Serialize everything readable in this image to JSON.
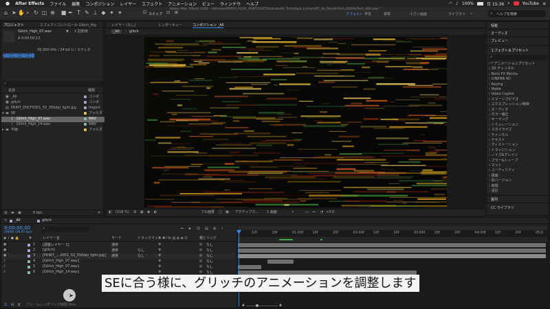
{
  "menubar": {
    "apple": "",
    "app_name": "After Effects",
    "items": [
      "ファイル",
      "編集",
      "コンポジション",
      "レイヤー",
      "エフェクト",
      "アニメーション",
      "ビュー",
      "ウィンドウ",
      "ヘルプ"
    ],
    "battery": "100%",
    "date": "日 15:36",
    "youtube": "YouTube"
  },
  "toolbar": {
    "window_title": "Adobe After Effects 2020 - /Volumes/PORT8_01/01_PORTEIGHT/Youtube/AE_Technique_Lecture/01_Ae_Rec/AeTech_004/AeTech_004.aep *",
    "snap_label": "スナップ",
    "workspaces": [
      "デフォルト",
      "学習",
      "標準",
      "小さい画面",
      "ライブラリ"
    ],
    "help_search": "ヘルプを検索"
  },
  "project": {
    "tab": "プロジェクト",
    "effect_controls_tab": "エフェクトコントロール Glitch_Hig",
    "file_name": "Glitch_High_07.wav",
    "file_usage": "▼ 、 2 回使用",
    "duration": "Δ 0;00;00;13",
    "audio_info": "56.000 kHz / 24 bit U / ステレオ",
    "search": "",
    "headers": [
      "名前",
      "種類"
    ],
    "items": [
      {
        "name": "_All",
        "type": "コンポ"
      },
      {
        "name": "glitch",
        "type": "コンポ"
      },
      {
        "name": "PRINT_DSCF0351_02_350dpi_light.jpg",
        "type": "Import"
      },
      {
        "name": "SE",
        "type": "フォルダ"
      },
      {
        "name": "Glitch_High_07.wav",
        "type": "WAV"
      },
      {
        "name": "Glitch_High_14.wav",
        "type": "WAV"
      },
      {
        "name": "平面",
        "type": "フォルダ"
      }
    ],
    "bpc": "8 bpc"
  },
  "viewer": {
    "tabs": [
      "レイヤー (なし)",
      "レンダーキュー",
      "コンポジション _All"
    ],
    "crumbs": [
      "_All",
      "glitch"
    ],
    "zoom": "(116 %)",
    "quality": "フル画質",
    "camera": "アクティブカ...",
    "views": "1 画面",
    "exposure": "+0.0"
  },
  "right_panel": {
    "info": "情報",
    "audio": "オーディオ",
    "preview": "プレビュー",
    "effects_title": "エフェクト＆プリセット",
    "search": "",
    "effects": [
      "* アニメーションプリセット",
      "3D チャンネル",
      "Boris FX Mocha",
      "CINEMA 4D",
      "Keying",
      "Matte",
      "Video Copilot",
      "イマーシブビデオ",
      "エクスプレッション制御",
      "オーディオ",
      "カラー補正",
      "キーイング",
      "シミュレーション",
      "スタイライズ",
      "チャンネル",
      "テキスト",
      "ディストーション",
      "トランジション",
      "ノイズ&グレイン",
      "ブラー&シャープ",
      "マット",
      "ユーティリティ",
      "描画",
      "旧バージョン",
      "時間",
      "遠近"
    ],
    "align": "整列",
    "libraries": "CC ライブラリ"
  },
  "timeline": {
    "tab_all": "_All",
    "tab_glitch": "glitch",
    "timecode": "0;00;00;00",
    "fps": "00000 (29.97 fps)",
    "search": "",
    "headers": {
      "layer": "レイヤー名",
      "mode": "モード",
      "trkmat": "トラックマット",
      "parent": "親とリンク"
    },
    "ruler": [
      "10f",
      "20f",
      "01:00f",
      "10f",
      "20f",
      "02:00f",
      "10f",
      "20f",
      "03:00f",
      "10f",
      "20f",
      "04:00f",
      "10f",
      "20f",
      "05:0"
    ],
    "layers": [
      {
        "num": "1",
        "name": "[調整レイヤー 1]",
        "mode": "通常",
        "trk": "",
        "parent": "なし"
      },
      {
        "num": "2",
        "name": "[glitch]",
        "mode": "通常",
        "trk": "なし",
        "parent": "なし"
      },
      {
        "num": "3",
        "name": "[PRINT_....0351_02_350dpi_light.jpg]",
        "mode": "通常",
        "trk": "なし",
        "parent": "なし"
      },
      {
        "num": "4",
        "name": "[Glitch_High_07.wav]",
        "mode": "",
        "trk": "",
        "parent": "なし"
      },
      {
        "num": "5",
        "name": "[Glitch_High_07.wav]",
        "mode": "",
        "trk": "",
        "parent": "なし"
      },
      {
        "num": "6",
        "name": "[Glitch_High_14.wav]",
        "mode": "",
        "trk": "",
        "parent": "なし"
      }
    ],
    "bars": [
      {
        "start": 0.0,
        "end": 1.0
      },
      {
        "start": 0.0,
        "end": 1.0
      },
      {
        "start": 0.0,
        "end": 1.0
      },
      {
        "start": 0.095,
        "end": 0.18
      },
      {
        "start": 0.0,
        "end": 0.075
      },
      {
        "start": 0.0,
        "end": 0.58
      }
    ],
    "bottom_label": "フレームレンダリング時間 0ms"
  },
  "subtitle": "SEに合う様に、グリッチのアニメーションを調整します",
  "colors": {
    "accent": "#2d8ceb",
    "blue_text": "#5aa0ff",
    "layer_bar": "#707070",
    "green": "#3aa84a"
  }
}
